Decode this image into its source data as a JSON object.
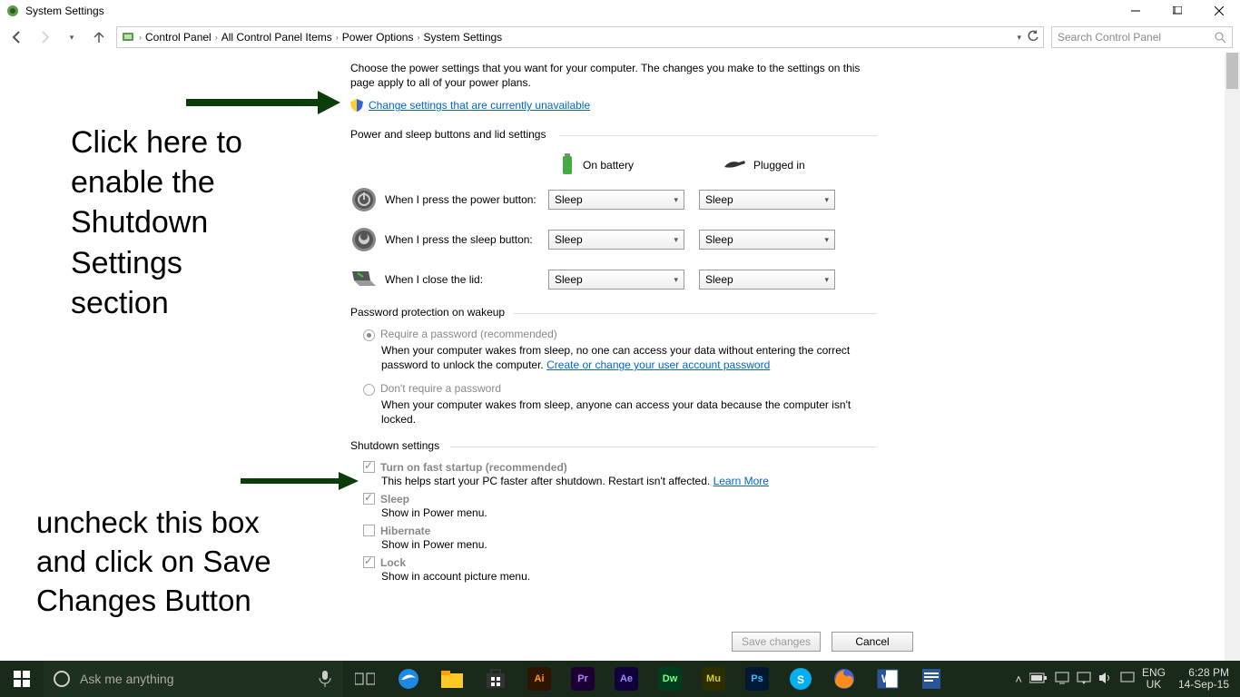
{
  "window": {
    "title": "System Settings"
  },
  "breadcrumb": [
    "Control Panel",
    "All Control Panel Items",
    "Power Options",
    "System Settings"
  ],
  "search_placeholder": "Search Control Panel",
  "intro": "Choose the power settings that you want for your computer. The changes you make to the settings on this page apply to all of your power plans.",
  "change_link": "Change settings that are currently unavailable",
  "buttons_section": {
    "title": "Power and sleep buttons and lid settings",
    "cols": {
      "battery": "On battery",
      "plugged": "Plugged in"
    },
    "rows": {
      "power": {
        "label": "When I press the power button:",
        "bat": "Sleep",
        "plug": "Sleep"
      },
      "sleep": {
        "label": "When I press the sleep button:",
        "bat": "Sleep",
        "plug": "Sleep"
      },
      "lid": {
        "label": "When I close the lid:",
        "bat": "Sleep",
        "plug": "Sleep"
      }
    }
  },
  "pwd": {
    "title": "Password protection on wakeup",
    "req": {
      "label": "Require a password (recommended)",
      "desc_a": "When your computer wakes from sleep, no one can access your data without entering the correct password to unlock the computer. ",
      "link": "Create or change your user account password"
    },
    "noreq": {
      "label": "Don't require a password",
      "desc": "When your computer wakes from sleep, anyone can access your data because the computer isn't locked."
    }
  },
  "shutdown": {
    "title": "Shutdown settings",
    "fast": {
      "label": "Turn on fast startup (recommended)",
      "desc": "This helps start your PC faster after shutdown. Restart isn't affected. ",
      "link": "Learn More"
    },
    "sleep": {
      "label": "Sleep",
      "desc": "Show in Power menu."
    },
    "hiber": {
      "label": "Hibernate",
      "desc": "Show in Power menu."
    },
    "lock": {
      "label": "Lock",
      "desc": "Show in account picture menu."
    }
  },
  "buttons": {
    "save": "Save changes",
    "cancel": "Cancel"
  },
  "annot": {
    "a1": "Click here to enable the Shutdown Settings section",
    "a2": "uncheck this box and click on Save Changes Button"
  },
  "taskbar": {
    "cortana": "Ask me anything",
    "lang1": "ENG",
    "lang2": "UK",
    "time": "6:28 PM",
    "date": "14-Sep-15"
  }
}
